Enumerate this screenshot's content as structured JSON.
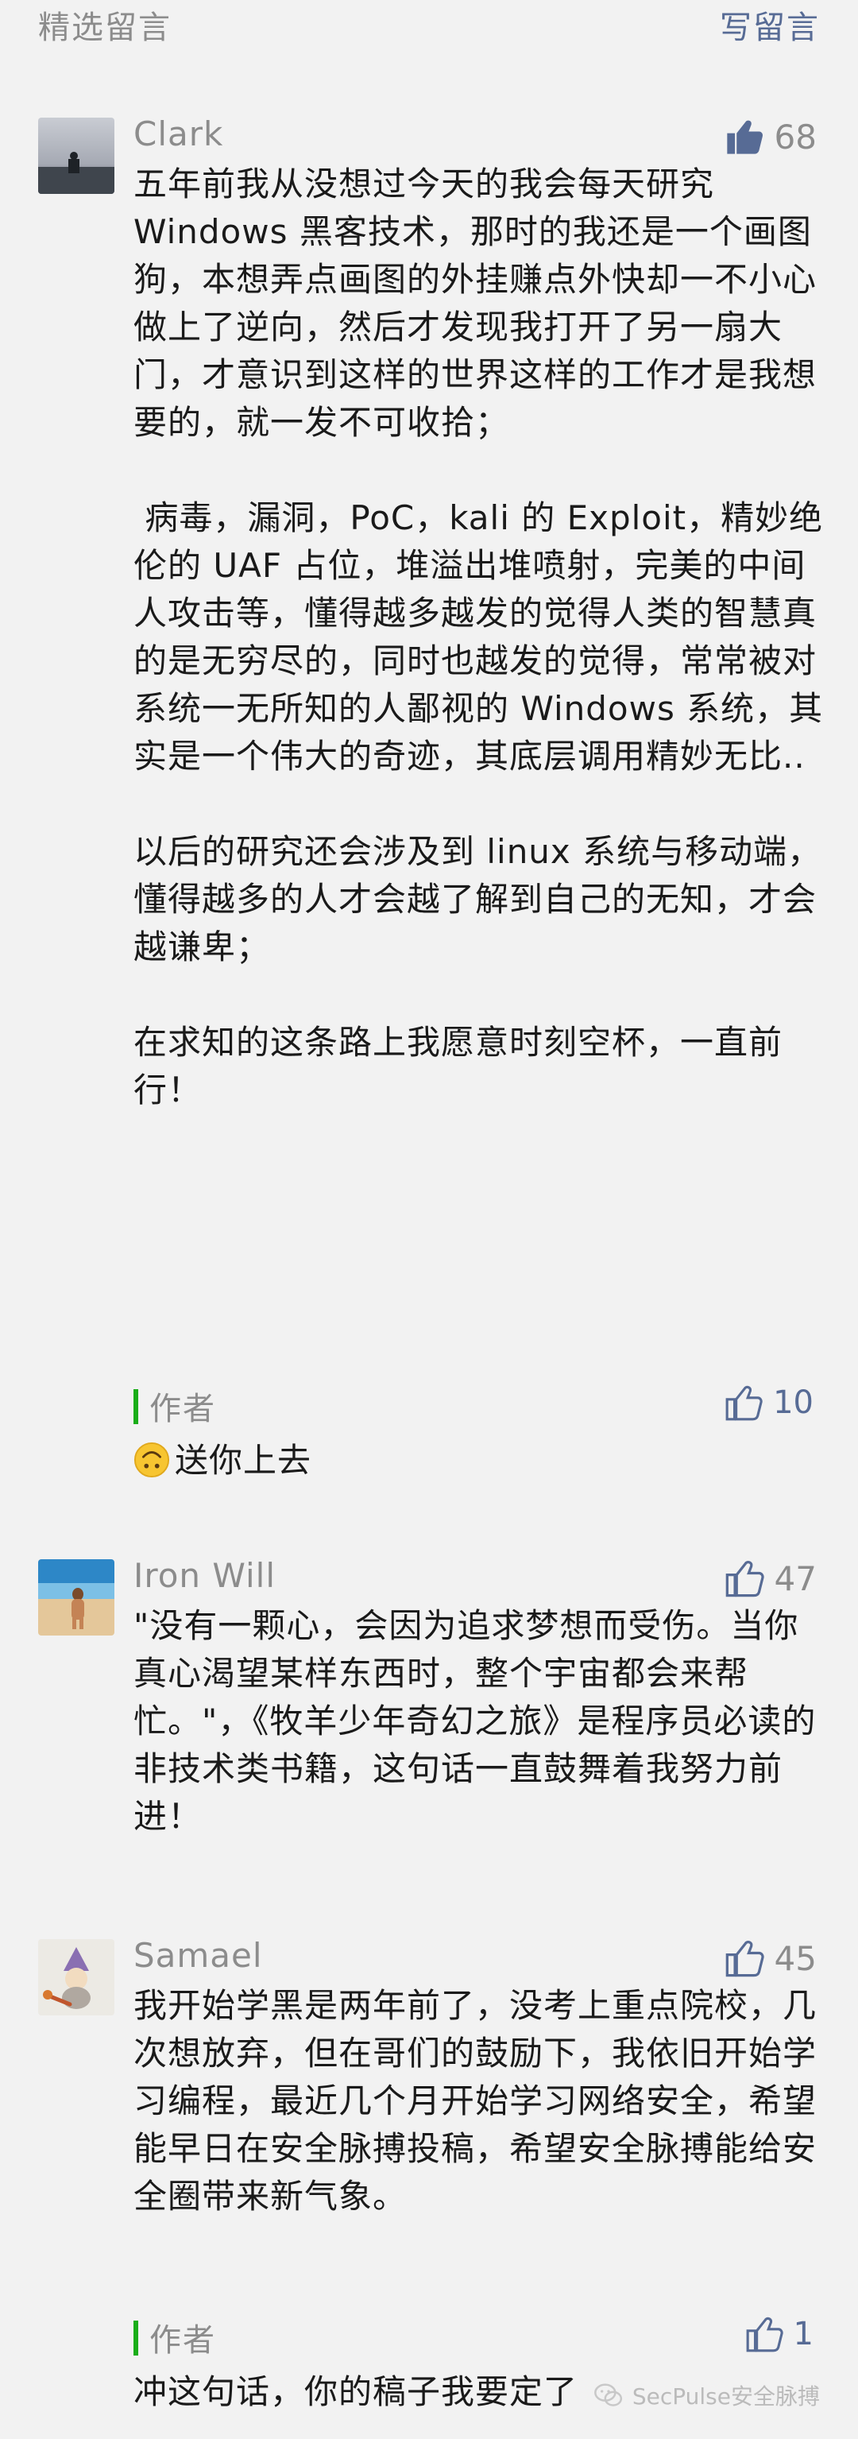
{
  "header": {
    "left_label": "精选留言",
    "right_label": "写留言"
  },
  "comments": [
    {
      "nickname": "Clark",
      "likes": "68",
      "text": "五年前我从没想过今天的我会每天研究Windows 黑客技术，那时的我还是一个画图狗，本想弄点画图的外挂赚点外快却一不小心做上了逆向，然后才发现我打开了另一扇大门，才意识到这样的世界这样的工作才是我想要的，就一发不可收拾；\n\n 病毒，漏洞，PoC，kali 的 Exploit，精妙绝伦的 UAF 占位，堆溢出堆喷射，完美的中间人攻击等，懂得越多越发的觉得人类的智慧真的是无穷尽的，同时也越发的觉得，常常被对系统一无所知的人鄙视的 Windows 系统，其实是一个伟大的奇迹，其底层调用精妙无比..\n\n以后的研究还会涉及到 linux 系统与移动端，懂得越多的人才会越了解到自己的无知，才会越谦卑；\n\n在求知的这条路上我愿意时刻空杯，一直前行！",
      "reply": {
        "label": "作者",
        "likes": "10",
        "text": "送你上去"
      }
    },
    {
      "nickname": "Iron Will",
      "likes": "47",
      "text": "\"没有一颗心，会因为追求梦想而受伤。当你真心渴望某样东西时，整个宇宙都会来帮忙。\"，《牧羊少年奇幻之旅》是程序员必读的非技术类书籍，这句话一直鼓舞着我努力前进！"
    },
    {
      "nickname": "Samael",
      "likes": "45",
      "text": "我开始学黑是两年前了，没考上重点院校，几次想放弃，但在哥们的鼓励下，我依旧开始学习编程，最近几个月开始学习网络安全，希望能早日在安全脉搏投稿，希望安全脉搏能给安全圈带来新气象。",
      "reply": {
        "label": "作者",
        "likes": "1",
        "text": "冲这句话，你的稿子我要定了"
      }
    }
  ],
  "watermark": "SecPulse安全脉搏",
  "colors": {
    "accent_green": "#1aad19",
    "link_blue": "#576b95",
    "meta_gray": "#8c8c8c"
  }
}
